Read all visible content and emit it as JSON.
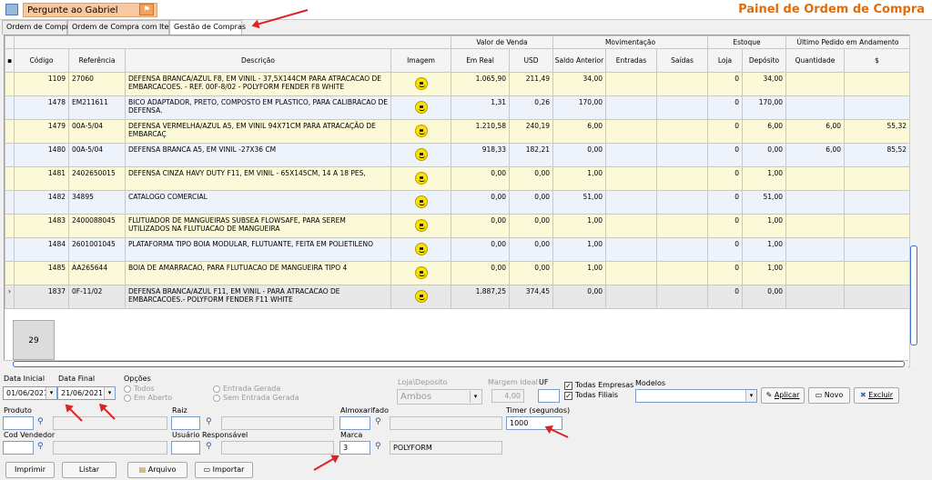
{
  "header": {
    "ask_text": "Pergunte ao Gabriel",
    "title": "Painel de Ordem de Compra"
  },
  "tabs": [
    "Ordem de Compra",
    "Ordem de Compra com Itens",
    "Gestão de Compras"
  ],
  "grid": {
    "group_headers": {
      "valor": "Valor de Venda",
      "mov": "Movimentação",
      "estoque": "Estoque",
      "ultimo": "Último Pedido em Andamento"
    },
    "columns": [
      "Código",
      "Referência",
      "Descrição",
      "Imagem",
      "Em Real",
      "USD",
      "Saldo Anterior",
      "Entradas",
      "Saídas",
      "Loja",
      "Depósito",
      "Quantidade",
      "$"
    ],
    "rows": [
      {
        "codigo": "1109",
        "ref": "27060",
        "desc": "DEFENSA BRANCA/AZUL F8, EM VINIL - 37,5X144CM PARA ATRACACAO DE EMBARCACOES. - REF. 00F-8/02 - POLYFORM FENDER F8 WHITE",
        "real": "1.065,90",
        "usd": "211,49",
        "saldo": "34,00",
        "entradas": "",
        "saidas": "",
        "loja": "0",
        "deposito": "34,00",
        "qtd": "",
        "preco": ""
      },
      {
        "codigo": "1478",
        "ref": "EM211611",
        "desc": "BICO ADAPTADOR, PRETO, COMPOSTO EM PLASTICO, PARA CALIBRACAO DE DEFENSA.",
        "real": "1,31",
        "usd": "0,26",
        "saldo": "170,00",
        "entradas": "",
        "saidas": "",
        "loja": "0",
        "deposito": "170,00",
        "qtd": "",
        "preco": ""
      },
      {
        "codigo": "1479",
        "ref": "00A-5/04",
        "desc": "DEFENSA VERMELHA/AZUL A5, EM VINIL 94X71CM PARA ATRACAÇÃO DE EMBARCAÇ",
        "real": "1.210,58",
        "usd": "240,19",
        "saldo": "6,00",
        "entradas": "",
        "saidas": "",
        "loja": "0",
        "deposito": "6,00",
        "qtd": "6,00",
        "preco": "55,32"
      },
      {
        "codigo": "1480",
        "ref": "00A-5/04",
        "desc": "DEFENSA BRANCA A5, EM VINIL -27X36 CM",
        "real": "918,33",
        "usd": "182,21",
        "saldo": "0,00",
        "entradas": "",
        "saidas": "",
        "loja": "0",
        "deposito": "0,00",
        "qtd": "6,00",
        "preco": "85,52"
      },
      {
        "codigo": "1481",
        "ref": "2402650015",
        "desc": "DEFENSA CINZA HAVY DUTY F11, EM VINIL - 65X145CM, 14 A 18 PES,",
        "real": "0,00",
        "usd": "0,00",
        "saldo": "1,00",
        "entradas": "",
        "saidas": "",
        "loja": "0",
        "deposito": "1,00",
        "qtd": "",
        "preco": ""
      },
      {
        "codigo": "1482",
        "ref": "34895",
        "desc": "CATALOGO COMERCIAL",
        "real": "0,00",
        "usd": "0,00",
        "saldo": "51,00",
        "entradas": "",
        "saidas": "",
        "loja": "0",
        "deposito": "51,00",
        "qtd": "",
        "preco": ""
      },
      {
        "codigo": "1483",
        "ref": "2400088045",
        "desc": "FLUTUADOR DE MANGUEIRAS SUBSEA FLOWSAFE, PARA SEREM UTILIZADOS NA FLUTUACAO DE MANGUEIRA",
        "real": "0,00",
        "usd": "0,00",
        "saldo": "1,00",
        "entradas": "",
        "saidas": "",
        "loja": "0",
        "deposito": "1,00",
        "qtd": "",
        "preco": ""
      },
      {
        "codigo": "1484",
        "ref": "2601001045",
        "desc": "PLATAFORMA TIPO BOIA MODULAR, FLUTUANTE, FEITA EM POLIETILENO",
        "real": "0,00",
        "usd": "0,00",
        "saldo": "1,00",
        "entradas": "",
        "saidas": "",
        "loja": "0",
        "deposito": "1,00",
        "qtd": "",
        "preco": ""
      },
      {
        "codigo": "1485",
        "ref": "AA265644",
        "desc": "BOIA DE AMARRACAO, PARA FLUTUACAO DE MANGUEIRA TIPO 4",
        "real": "0,00",
        "usd": "0,00",
        "saldo": "1,00",
        "entradas": "",
        "saidas": "",
        "loja": "0",
        "deposito": "1,00",
        "qtd": "",
        "preco": ""
      },
      {
        "codigo": "1837",
        "ref": "0F-11/02",
        "desc": "DEFENSA BRANCA/AZUL F11, EM VINIL - PARA ATRACACAO DE EMBARCACOES.- POLYFORM FENDER F11 WHITE",
        "real": "1.887,25",
        "usd": "374,45",
        "saldo": "0,00",
        "entradas": "",
        "saidas": "",
        "loja": "0",
        "deposito": "0,00",
        "qtd": "",
        "preco": ""
      }
    ],
    "footer_count": "29"
  },
  "filters": {
    "data_inicial_label": "Data Inicial",
    "data_inicial": "01/06/2021",
    "data_final_label": "Data Final",
    "data_final": "21/06/2021",
    "opcoes_label": "Opções",
    "opt_todos": "Todos",
    "opt_em_aberto": "Em Aberto",
    "opt_entrada_gerada": "Entrada Gerada",
    "opt_sem_entrada": "Sem Entrada Gerada",
    "loja_label": "Loja\\Deposito",
    "loja_value": "Ambos",
    "margem_label": "Margem Ideal",
    "margem_value": "4,00",
    "uf_label": "UF",
    "uf_value": "",
    "todas_empresas": "Todas Empresas",
    "todas_filiais": "Todas Filiais",
    "modelos_label": "Modelos",
    "modelos_value": "",
    "aplicar": "Aplicar",
    "novo": "Novo",
    "excluir": "Excluir",
    "produto_label": "Produto",
    "raiz_label": "Raiz",
    "almox_label": "Almoxarifado",
    "timer_label": "Timer (segundos)",
    "timer_value": "1000",
    "vendedor_label": "Cod Vendedor",
    "usuario_label": "Usuário Responsável",
    "marca_label": "Marca",
    "marca_code": "3",
    "marca_name": "POLYFORM"
  },
  "buttons": {
    "imprimir": "Imprimir",
    "listar": "Listar",
    "arquivo": "Arquivo",
    "importar": "Importar"
  },
  "colors": {
    "title": "#e36c09",
    "row_yellow": "#fbf9d8",
    "row_blue": "#eef2fb",
    "annotation": "#d22222"
  }
}
